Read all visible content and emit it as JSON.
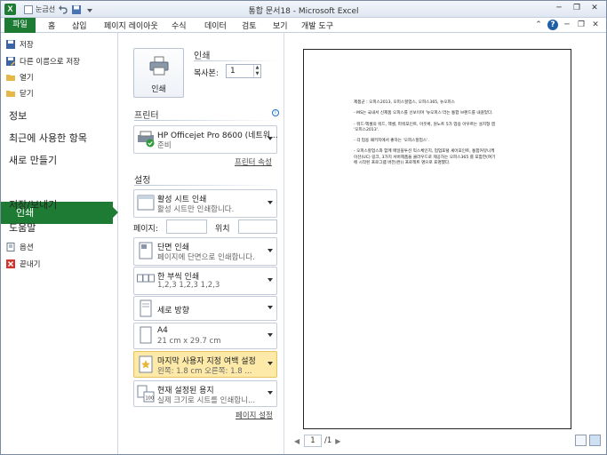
{
  "window": {
    "title": "통합 문서18 - Microsoft Excel"
  },
  "quick_access": {
    "logo": "X",
    "font_label": "눈금선"
  },
  "tabs": [
    "파일",
    "홈",
    "삽입",
    "페이지 레이아웃",
    "수식",
    "데이터",
    "검토",
    "보기",
    "개발 도구"
  ],
  "nav": {
    "save": "저장",
    "save_as": "다른 이름으로 저장",
    "open": "열기",
    "close": "닫기",
    "info": "정보",
    "recent": "최근에 사용한 항목",
    "new": "새로 만들기",
    "print": "인쇄",
    "save_send": "저장/보내기",
    "help": "도움말",
    "options": "옵션",
    "exit": "끝내기"
  },
  "print": {
    "button_label": "인쇄",
    "heading": "인쇄",
    "copies_label": "복사본:",
    "copies_value": "1"
  },
  "printer": {
    "heading": "프린터",
    "name": "HP Officejet Pro 8600 (네트워...",
    "status": "준비",
    "properties_link": "프린터 속성"
  },
  "settings": {
    "heading": "설정",
    "scope_title": "활성 시트 인쇄",
    "scope_sub": "활성 시트만 인쇄합니다.",
    "pages_label": "페이지:",
    "to_label": "위치",
    "sides_title": "단면 인쇄",
    "sides_sub": "페이지에 단면으로 인쇄합니다.",
    "collate_title": "한 부씩 인쇄",
    "collate_sub": "1,2,3    1,2,3    1,2,3",
    "orientation_title": "세로 방향",
    "paper_title": "A4",
    "paper_sub": "21 cm x 29.7 cm",
    "margins_title": "마지막 사용자 지정 여백 설정",
    "margins_sub": "왼쪽:  1.8 cm    오른쪽:  1.8 ...",
    "scaling_title": "현재 설정된 용지",
    "scaling_sub": "실제 크기로 시트를 인쇄합니...",
    "page_setup_link": "페이지 설정"
  },
  "preview": {
    "lines": [
      "제품군 : 오피스2013, 오피스할업스, 오피스365, 뉴오피스",
      "- MS는 국내서 신제품 오피스를 선보이며 '뉴오피스'라는 통합 브랜드를 내걸었다.",
      "- 워드·엑셀의 워드, 엑셀, 파워포인트, 아웃룩, 원노트 5가 업용 아우르는 설치형 앱 '오피스2013'.",
      "- 각 업용 패키지에서 좋하는 '오피스할업스'.",
      "- 오피스할업스와 함께 메일블투션 익스체인지, 업업포털 셰어포인트, 통합커뮤니케이션(UC) 링크, 3가지 서버제품을 클라우드로 제공하는 오피스365 를 포함한(여기에 시작된 프로그램 버전(완)) 프로젝트 명으로 표명했다."
    ],
    "page_current": "1",
    "page_total": "/1"
  }
}
